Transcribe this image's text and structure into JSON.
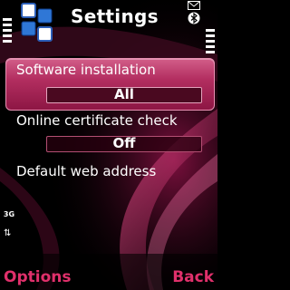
{
  "window": {
    "title": "Settings"
  },
  "status": {
    "network_mode": "3G"
  },
  "settings": [
    {
      "label": "Software installation",
      "value": "All",
      "selected": true
    },
    {
      "label": "Online certificate check",
      "value": "Off",
      "selected": false
    },
    {
      "label": "Default web address",
      "value": "",
      "selected": false
    }
  ],
  "softkeys": {
    "left": "Options",
    "right": "Back"
  },
  "colors": {
    "accent": "#e0306b",
    "highlight": "#b32e60",
    "background": "#000000"
  }
}
